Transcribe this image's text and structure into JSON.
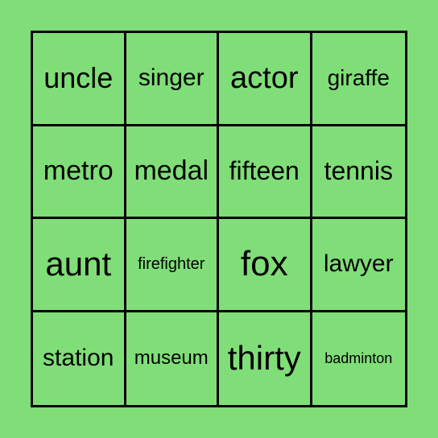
{
  "card": {
    "background_color": "#80de78",
    "cells": [
      {
        "word": "uncle",
        "size": 36
      },
      {
        "word": "singer",
        "size": 30
      },
      {
        "word": "actor",
        "size": 38
      },
      {
        "word": "giraffe",
        "size": 28
      },
      {
        "word": "metro",
        "size": 34
      },
      {
        "word": "medal",
        "size": 34
      },
      {
        "word": "fifteen",
        "size": 32
      },
      {
        "word": "tennis",
        "size": 32
      },
      {
        "word": "aunt",
        "size": 42
      },
      {
        "word": "firefighter",
        "size": 20
      },
      {
        "word": "fox",
        "size": 44
      },
      {
        "word": "lawyer",
        "size": 30
      },
      {
        "word": "station",
        "size": 30
      },
      {
        "word": "museum",
        "size": 24
      },
      {
        "word": "thirty",
        "size": 42
      },
      {
        "word": "badminton",
        "size": 18
      }
    ]
  }
}
